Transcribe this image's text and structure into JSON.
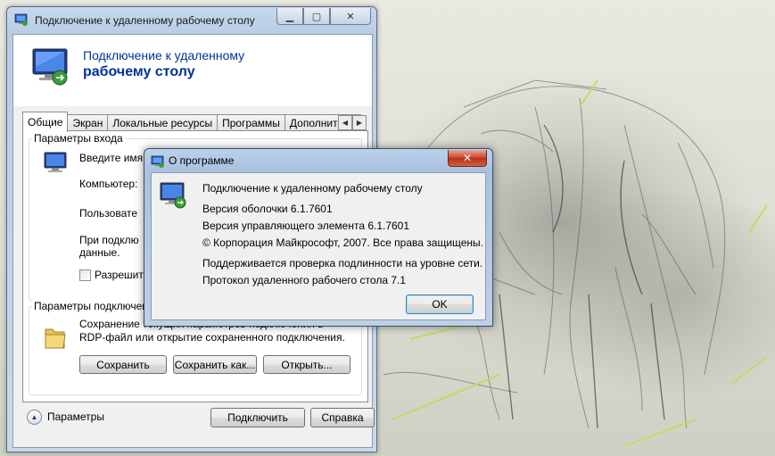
{
  "main_window": {
    "title": "Подключение к удаленному рабочему столу",
    "banner_line1": "Подключение к удаленному",
    "banner_line2": "рабочему столу",
    "tabs": [
      "Общие",
      "Экран",
      "Локальные ресурсы",
      "Программы",
      "Дополнитель"
    ],
    "logon_group_label": "Параметры входа",
    "logon_prompt": "Введите имя у",
    "computer_label": "Компьютер:",
    "user_label": "Пользовате",
    "info_line1": "При подклю",
    "info_line2": "данные.",
    "allow_checkbox_label": "Разрешит",
    "connection_group_label": "Параметры подключени",
    "save_text_line1": "Сохранение текущих параметров подключения в",
    "save_text_line2": "RDP-файл или открытие сохраненного подключения.",
    "save_button": "Сохранить",
    "save_as_button": "Сохранить как...",
    "open_button": "Открыть...",
    "options_label": "Параметры",
    "connect_button": "Подключить",
    "help_button": "Справка"
  },
  "about_dialog": {
    "title": "О программе",
    "product_name": "Подключение к удаленному рабочему столу",
    "shell_version": "Версия оболочки 6.1.7601",
    "control_version": "Версия управляющего элемента 6.1.7601",
    "copyright": "© Корпорация Майкрософт, 2007. Все права защищены.",
    "nla_support": "Поддерживается проверка подлинности на уровне сети.",
    "protocol": "Протокол удаленного рабочего стола 7.1",
    "ok_button": "OK"
  },
  "colors": {
    "banner_text": "#003399",
    "title_bar": "#b8cde4",
    "close_button": "#c8462f"
  }
}
